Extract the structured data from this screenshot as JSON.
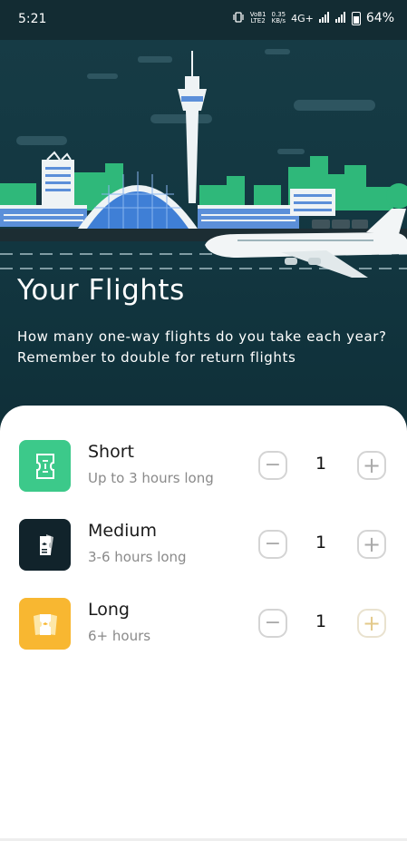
{
  "status_bar": {
    "time": "5:21",
    "network_label_top": "VoB1",
    "network_label_bottom": "LTE2",
    "speed_top": "0.35",
    "speed_bottom": "KB/s",
    "network_type": "4G+",
    "battery_percent": "64%"
  },
  "hero": {
    "title": "Your Flights",
    "subtitle": "How many one-way flights do you take each year? Remember to double for return flights"
  },
  "flights": [
    {
      "name": "Short",
      "description": "Up to 3 hours long",
      "count": "1",
      "color": "#3cc98a",
      "icon": "ticket-icon"
    },
    {
      "name": "Medium",
      "description": "3-6 hours long",
      "count": "1",
      "color": "#11232b",
      "icon": "boarding-pass-icon"
    },
    {
      "name": "Long",
      "description": "6+ hours",
      "count": "1",
      "color": "#f8b731",
      "icon": "tickets-icon"
    }
  ],
  "controls": {
    "minus_symbol": "−",
    "plus_symbol": "+"
  },
  "colors": {
    "hero_background": "#163b45",
    "accent_green": "#3cc98a",
    "accent_yellow": "#f8b731"
  }
}
